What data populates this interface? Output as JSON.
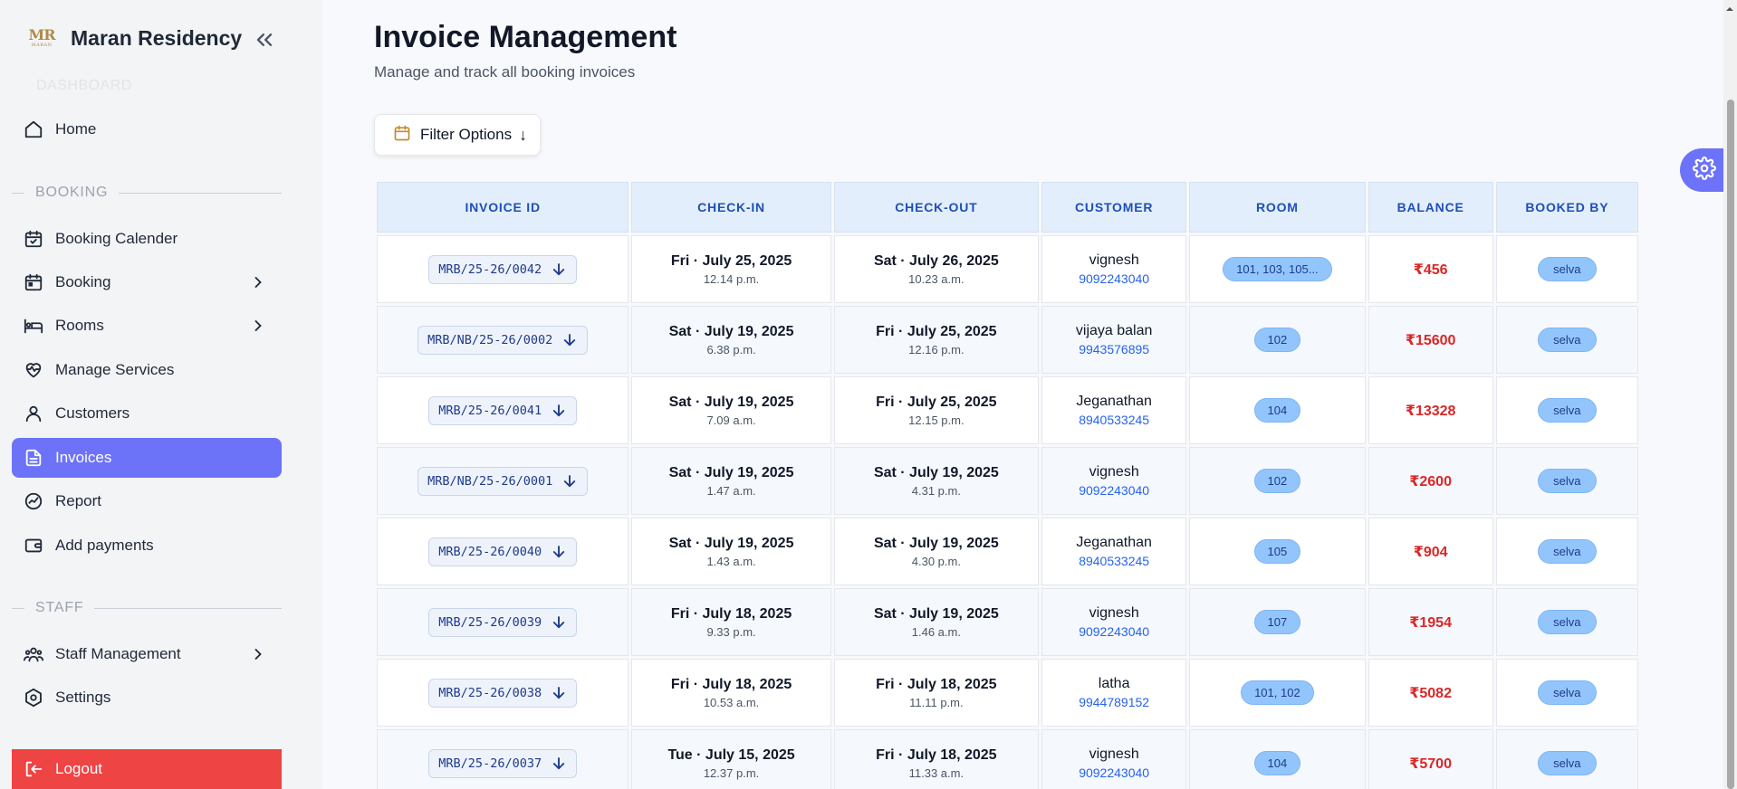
{
  "brand": {
    "name": "Maran Residency",
    "logo_initials": "MR",
    "logo_sub": "MARAN"
  },
  "sidebar": {
    "faded_label": "DASHBOARD",
    "home": "Home",
    "booking_section": "BOOKING",
    "booking_calender": "Booking Calender",
    "booking": "Booking",
    "rooms": "Rooms",
    "manage_services": "Manage Services",
    "customers": "Customers",
    "invoices": "Invoices",
    "report": "Report",
    "add_payments": "Add payments",
    "staff_section": "STAFF",
    "staff_management": "Staff Management",
    "settings": "Settings",
    "logout": "Logout"
  },
  "header": {
    "title": "Invoice Management",
    "subtitle": "Manage and track all booking invoices",
    "filter_label": "Filter Options",
    "filter_arrow": "↓"
  },
  "table": {
    "columns": [
      "INVOICE ID",
      "CHECK-IN",
      "CHECK-OUT",
      "CUSTOMER",
      "ROOM",
      "BALANCE",
      "BOOKED BY"
    ],
    "rows": [
      {
        "invoice_id": "MRB/25-26/0042",
        "checkin_date": "Fri · July 25, 2025",
        "checkin_time": "12.14 p.m.",
        "checkout_date": "Sat · July 26, 2025",
        "checkout_time": "10.23 a.m.",
        "customer": "vignesh",
        "phone": "9092243040",
        "room": "101, 103, 105...",
        "balance": "₹456",
        "booked_by": "selva"
      },
      {
        "invoice_id": "MRB/NB/25-26/0002",
        "checkin_date": "Sat · July 19, 2025",
        "checkin_time": "6.38 p.m.",
        "checkout_date": "Fri · July 25, 2025",
        "checkout_time": "12.16 p.m.",
        "customer": "vijaya balan",
        "phone": "9943576895",
        "room": "102",
        "balance": "₹15600",
        "booked_by": "selva"
      },
      {
        "invoice_id": "MRB/25-26/0041",
        "checkin_date": "Sat · July 19, 2025",
        "checkin_time": "7.09 a.m.",
        "checkout_date": "Fri · July 25, 2025",
        "checkout_time": "12.15 p.m.",
        "customer": "Jeganathan",
        "phone": "8940533245",
        "room": "104",
        "balance": "₹13328",
        "booked_by": "selva"
      },
      {
        "invoice_id": "MRB/NB/25-26/0001",
        "checkin_date": "Sat · July 19, 2025",
        "checkin_time": "1.47 a.m.",
        "checkout_date": "Sat · July 19, 2025",
        "checkout_time": "4.31 p.m.",
        "customer": "vignesh",
        "phone": "9092243040",
        "room": "102",
        "balance": "₹2600",
        "booked_by": "selva"
      },
      {
        "invoice_id": "MRB/25-26/0040",
        "checkin_date": "Sat · July 19, 2025",
        "checkin_time": "1.43 a.m.",
        "checkout_date": "Sat · July 19, 2025",
        "checkout_time": "4.30 p.m.",
        "customer": "Jeganathan",
        "phone": "8940533245",
        "room": "105",
        "balance": "₹904",
        "booked_by": "selva"
      },
      {
        "invoice_id": "MRB/25-26/0039",
        "checkin_date": "Fri · July 18, 2025",
        "checkin_time": "9.33 p.m.",
        "checkout_date": "Sat · July 19, 2025",
        "checkout_time": "1.46 a.m.",
        "customer": "vignesh",
        "phone": "9092243040",
        "room": "107",
        "balance": "₹1954",
        "booked_by": "selva"
      },
      {
        "invoice_id": "MRB/25-26/0038",
        "checkin_date": "Fri · July 18, 2025",
        "checkin_time": "10.53 a.m.",
        "checkout_date": "Fri · July 18, 2025",
        "checkout_time": "11.11 p.m.",
        "customer": "latha",
        "phone": "9944789152",
        "room": "101, 102",
        "balance": "₹5082",
        "booked_by": "selva"
      },
      {
        "invoice_id": "MRB/25-26/0037",
        "checkin_date": "Tue · July 15, 2025",
        "checkin_time": "12.37 p.m.",
        "checkout_date": "Fri · July 18, 2025",
        "checkout_time": "11.33 a.m.",
        "customer": "vignesh",
        "phone": "9092243040",
        "room": "104",
        "balance": "₹5700",
        "booked_by": "selva"
      }
    ]
  },
  "colors": {
    "accent": "#6c73f8",
    "danger": "#ef4444",
    "header_blue": "#1e4fb8",
    "pill_blue": "#93c5fd",
    "balance_red": "#dc2626"
  }
}
